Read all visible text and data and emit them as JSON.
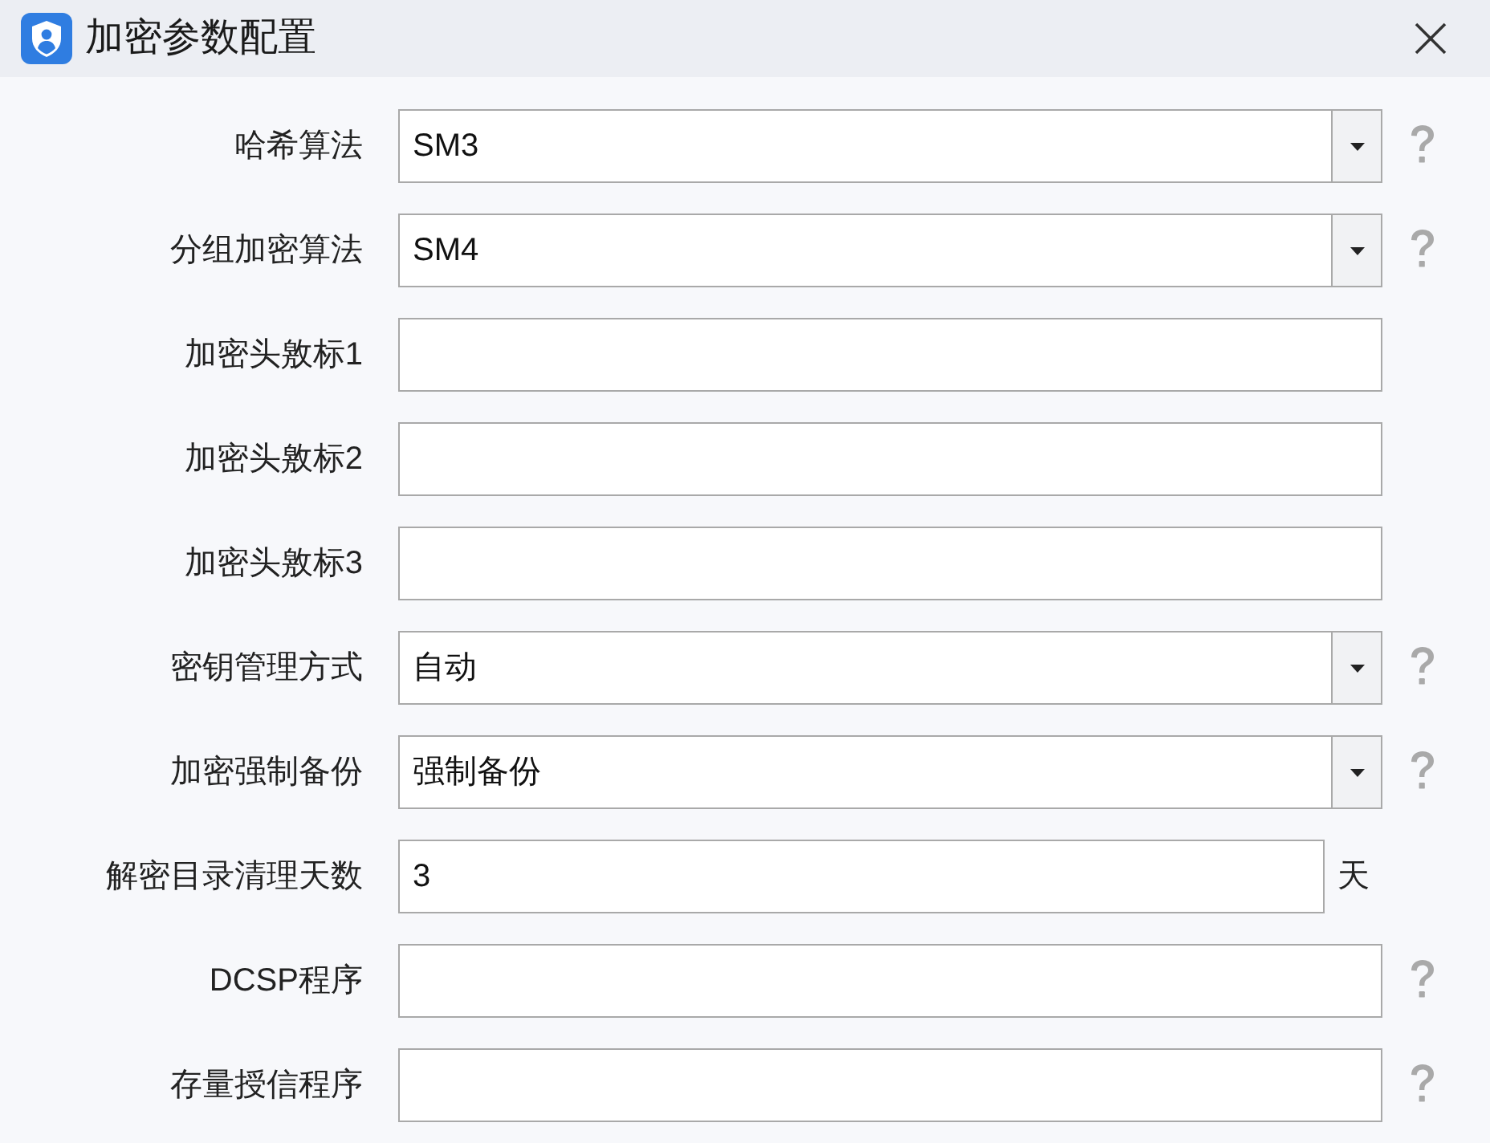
{
  "window": {
    "title": "加密参数配置"
  },
  "fields": [
    {
      "label": "哈希算法",
      "kind": "select",
      "value": "SM3",
      "help": true
    },
    {
      "label": "分组加密算法",
      "kind": "select",
      "value": "SM4",
      "help": true
    },
    {
      "label": "加密头敫标1",
      "kind": "text",
      "help": false
    },
    {
      "label": "加密头敫标2",
      "kind": "text",
      "help": false
    },
    {
      "label": "加密头敫标3",
      "kind": "text",
      "help": false
    },
    {
      "label": "密钥管理方式",
      "kind": "select",
      "value": "自动",
      "help": true
    },
    {
      "label": "加密强制备份",
      "kind": "select",
      "value": "强制备份",
      "help": true
    },
    {
      "label": "解密目录清理天数",
      "kind": "text",
      "value": "3",
      "unit": "天",
      "help": false
    },
    {
      "label": "DCSP程序",
      "kind": "text",
      "help": true
    },
    {
      "label": "存量授信程序",
      "kind": "text",
      "help": true
    }
  ]
}
